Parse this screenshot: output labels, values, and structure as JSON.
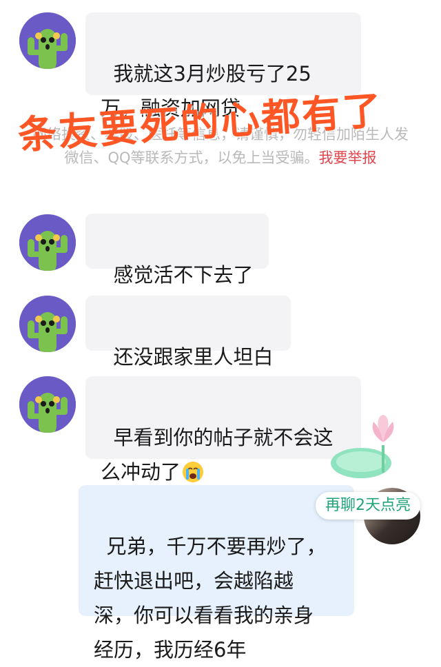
{
  "chat": {
    "messages": [
      {
        "lines": "我就这3月炒股亏了25\n万，融资加网贷"
      },
      {
        "lines": "感觉活不下去了"
      },
      {
        "lines": "还没跟家里人坦白"
      },
      {
        "lines": "早看到你的帖子就不会这\n么冲动了"
      },
      {
        "lines": "兄弟，千万不要再炒了，\n赶快退出吧，会越陷越\n深，你可以看看我的亲身\n经历，我历经6年"
      }
    ],
    "notice": {
      "text": "网络投资、荐股、医托等信息，请谨慎，勿轻信加陌生人发微信、QQ等联系方式，以免上当受骗。",
      "report_link": "我要举报"
    }
  },
  "overlay": {
    "caption": "条友要死的心都有了"
  },
  "promo": {
    "label": "再聊2天点亮"
  },
  "icons": {
    "avatar": "cactus-avatar-icon",
    "emoji": "crying-face-icon",
    "lotus": "lotus-badge-icon"
  },
  "colors": {
    "avatar_bg": "#6a5ac6",
    "cactus": "#7cc24e",
    "bubble_other": "#f3f3f5",
    "bubble_mine": "#e6f1fd",
    "overlay_red": "#ff5626",
    "report_red": "#e0474c",
    "promo_green": "#21a37a"
  }
}
